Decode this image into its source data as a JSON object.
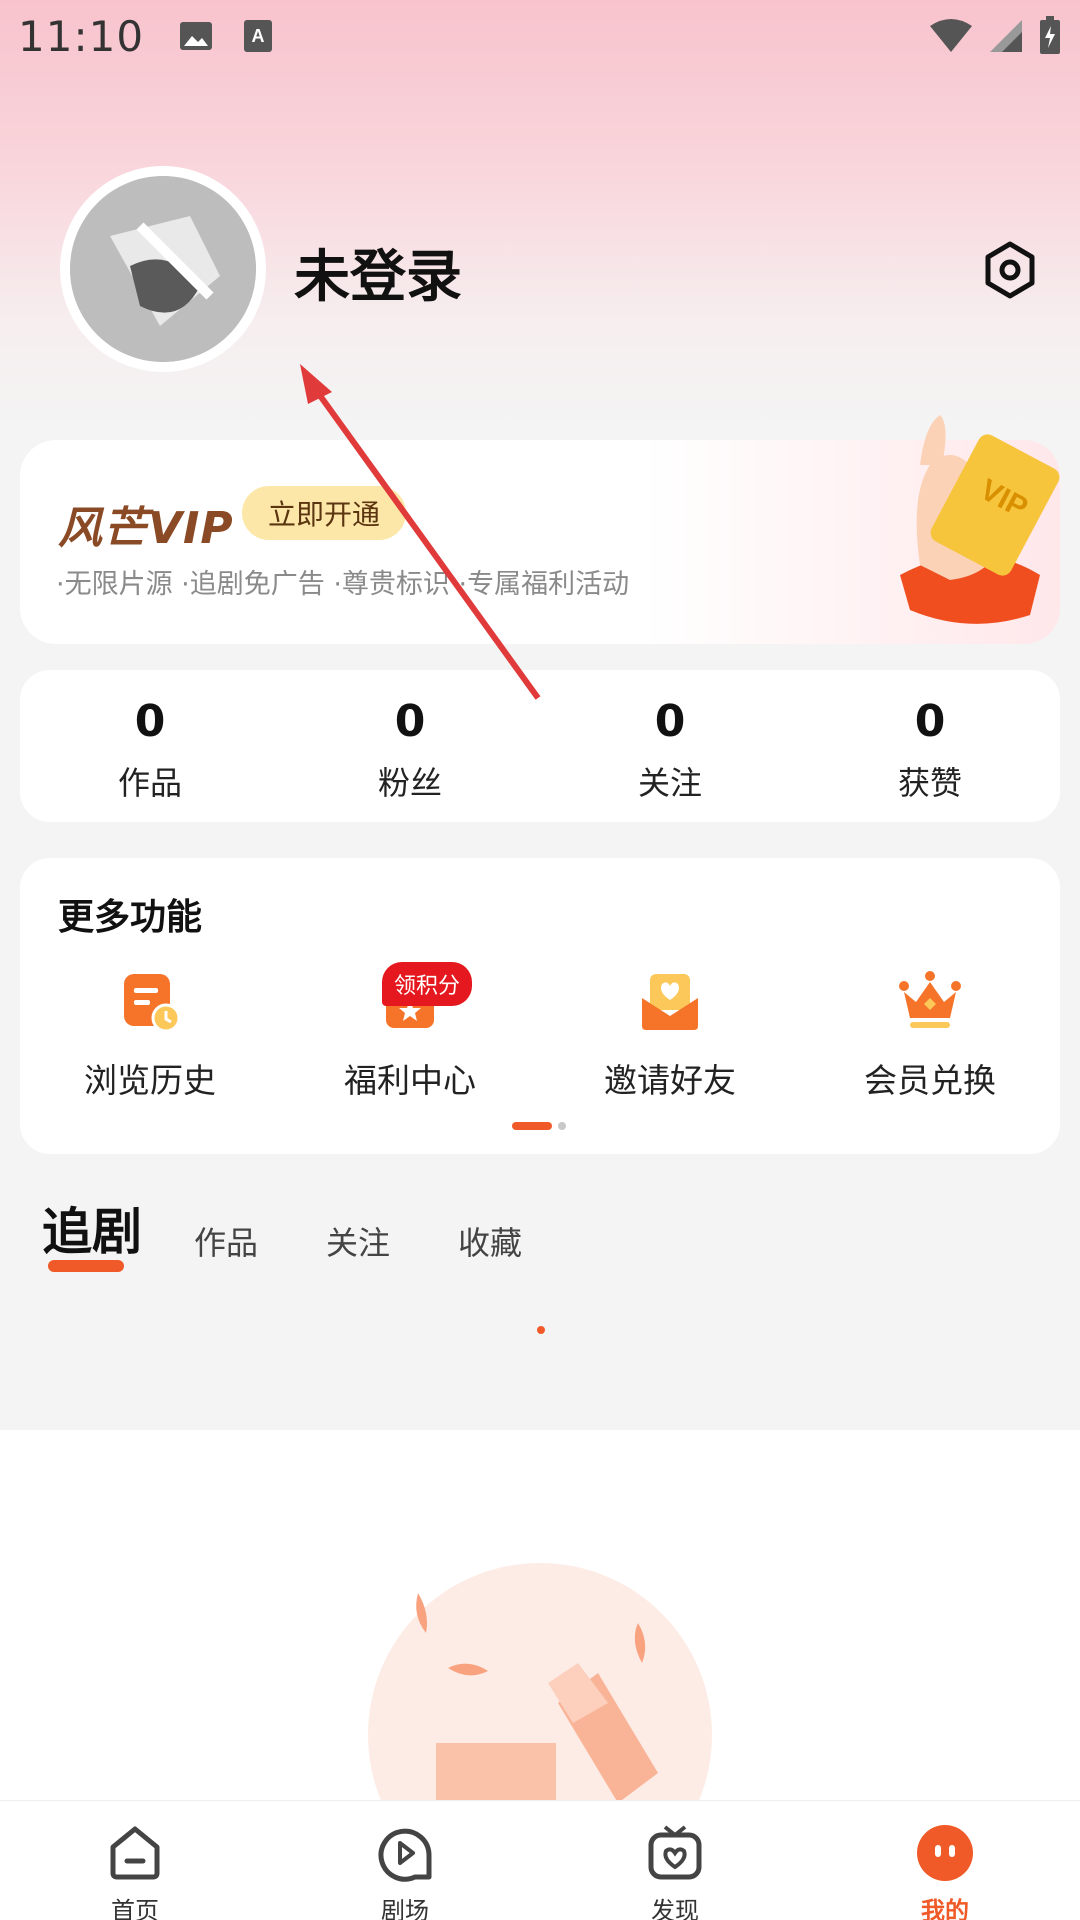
{
  "status_bar": {
    "time": "11:10"
  },
  "profile": {
    "name": "未登录"
  },
  "vip": {
    "logo": "风芒VIP",
    "open_button": "立即开通",
    "description": "·无限片源 ·追剧免广告 ·尊贵标识 ·专属福利活动"
  },
  "stats": [
    {
      "value": "0",
      "label": "作品"
    },
    {
      "value": "0",
      "label": "粉丝"
    },
    {
      "value": "0",
      "label": "关注"
    },
    {
      "value": "0",
      "label": "获赞"
    }
  ],
  "more": {
    "title": "更多功能",
    "badge": "领积分",
    "features": [
      {
        "label": "浏览历史",
        "icon": "history-icon"
      },
      {
        "label": "福利中心",
        "icon": "gift-icon"
      },
      {
        "label": "邀请好友",
        "icon": "invite-envelope-icon"
      },
      {
        "label": "会员兑换",
        "icon": "crown-icon"
      }
    ]
  },
  "tabs": [
    {
      "label": "追剧"
    },
    {
      "label": "作品"
    },
    {
      "label": "关注"
    },
    {
      "label": "收藏"
    }
  ],
  "bottom_nav": [
    {
      "label": "首页",
      "icon": "home-icon"
    },
    {
      "label": "剧场",
      "icon": "play-icon"
    },
    {
      "label": "发现",
      "icon": "tv-heart-icon"
    },
    {
      "label": "我的",
      "icon": "profile-icon"
    }
  ],
  "colors": {
    "accent": "#f05a28",
    "vip_brown": "#8a4a25",
    "badge_red": "#e4181e"
  }
}
